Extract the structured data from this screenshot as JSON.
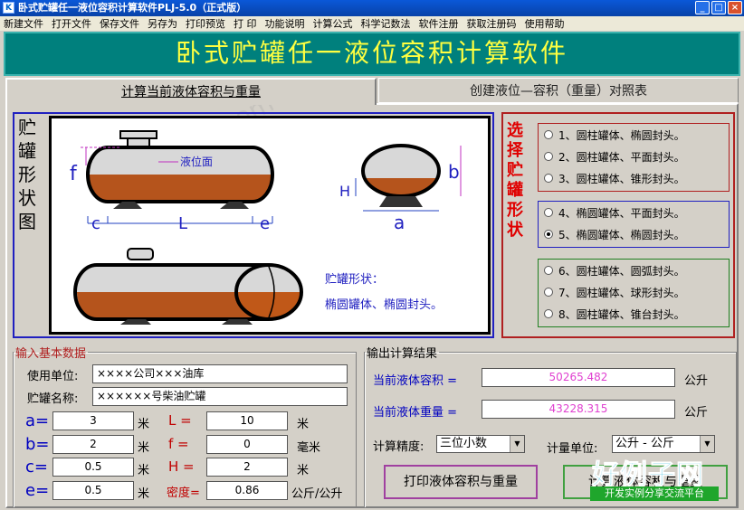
{
  "window": {
    "title": "卧式贮罐任一液位容积计算软件PLJ-5.0（正式版）",
    "app_icon": "K",
    "controls": {
      "minimize": "_",
      "maximize": "□",
      "close": "×"
    }
  },
  "menu": [
    "新建文件",
    "打开文件",
    "保存文件",
    "另存为",
    "打印预览",
    "打 印",
    "功能说明",
    "计算公式",
    "科学记数法",
    "软件注册",
    "获取注册码",
    "使用帮助"
  ],
  "banner": "卧式贮罐任一液位容积计算软件",
  "tabs": {
    "active": "计算当前液体容积与重量",
    "inactive": "创建液位—容积（重量）对照表"
  },
  "shape_section": {
    "vertical_title": [
      "贮",
      "罐",
      "形",
      "状",
      "图"
    ],
    "labels": {
      "f": "f",
      "c": "c",
      "L": "L",
      "e": "e",
      "H": "H",
      "a": "a",
      "b": "b",
      "liquid_level": "液位面"
    },
    "caption_title": "贮罐形状：",
    "caption_value": "椭圆罐体、椭圆封头。"
  },
  "selection": {
    "vertical_title": [
      "选",
      "择",
      "贮",
      "罐",
      "形",
      "状"
    ],
    "groups": [
      {
        "color": "#b02020",
        "options": [
          "1、圆柱罐体、椭圆封头。",
          "2、圆柱罐体、平面封头。",
          "3、圆柱罐体、锥形封头。"
        ]
      },
      {
        "color": "#2020c0",
        "options": [
          "4、椭圆罐体、平面封头。",
          "5、椭圆罐体、椭圆封头。"
        ]
      },
      {
        "color": "#208020",
        "options": [
          "6、圆柱罐体、圆弧封头。",
          "7、圆柱罐体、球形封头。",
          "8、圆柱罐体、锥台封头。"
        ]
      }
    ],
    "selected": "5、椭圆罐体、椭圆封头。"
  },
  "input": {
    "legend": "输入基本数据",
    "unit_label": "使用单位:",
    "unit_value": "××××公司×××油库",
    "tank_label": "贮罐名称:",
    "tank_value": "××××××号柴油贮罐",
    "params": {
      "a": {
        "name": "a=",
        "value": "3",
        "unit": "米"
      },
      "b": {
        "name": "b=",
        "value": "2",
        "unit": "米"
      },
      "c": {
        "name": "c=",
        "value": "0.5",
        "unit": "米"
      },
      "e": {
        "name": "e=",
        "value": "0.5",
        "unit": "米"
      },
      "L": {
        "name": "L =",
        "value": "10",
        "unit": "米"
      },
      "f": {
        "name": "f =",
        "value": "0",
        "unit": "毫米"
      },
      "H": {
        "name": "H =",
        "value": "2",
        "unit": "米"
      },
      "density": {
        "name": "密度=",
        "value": "0.86",
        "unit": "公斤/公升"
      }
    }
  },
  "output": {
    "legend": "输出计算结果",
    "volume_label": "当前液体容积 =",
    "volume_value": "50265.482",
    "volume_unit": "公升",
    "weight_label": "当前液体重量 =",
    "weight_value": "43228.315",
    "weight_unit": "公斤",
    "precision_label": "计算精度:",
    "precision_value": "三位小数",
    "measure_label": "计量单位:",
    "measure_value": "公升 - 公斤",
    "print_button": "打印液体容积与重量",
    "calc_button": "计算液体容积与重量"
  },
  "watermark_logo": {
    "big": "好例子网",
    "small": "开发实例分享交流平台"
  },
  "watermark_text": "www.haolizi.com",
  "colors": {
    "banner_bg": "#00807d",
    "banner_text": "#ffff40",
    "liquid": "#b5541c",
    "tank": "#d8d8d8",
    "pink_value": "#e040d0"
  }
}
